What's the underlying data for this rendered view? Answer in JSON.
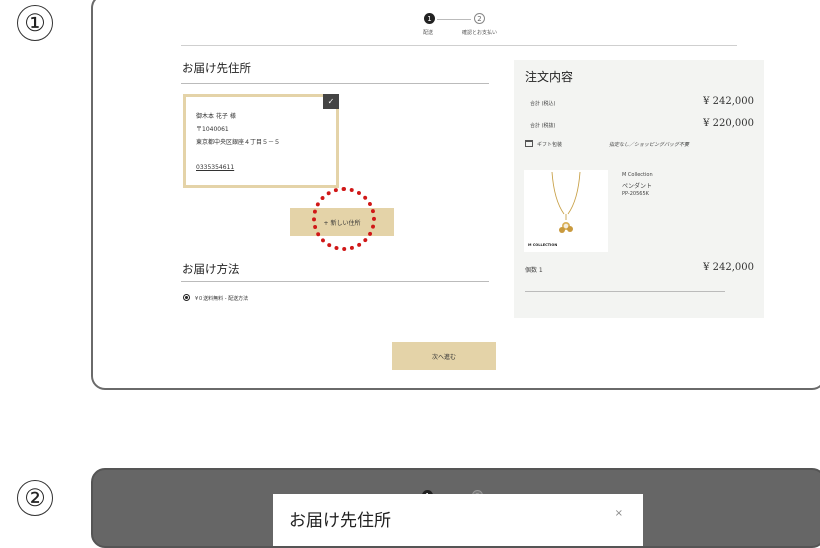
{
  "markers": {
    "first": "①",
    "second": "②"
  },
  "stepper": {
    "step1_number": "1",
    "step1_label": "配送",
    "step2_number": "2",
    "step2_label": "確認とお支払い"
  },
  "shipping_address": {
    "heading": "お届け先住所",
    "name": "御木本 花子 様",
    "postal": "〒1040061",
    "address": "東京都中央区銀座４丁目５－５",
    "phone": "0335354611",
    "check_glyph": "✓",
    "new_address_label": "+ 新しい住所"
  },
  "delivery_method": {
    "heading": "お届け方法",
    "option_label": "¥０送料無料 - 配送方法"
  },
  "next_button_label": "次へ進む",
  "order_summary": {
    "heading": "注文内容",
    "total_incl_label": "合計 (税込)",
    "total_incl_value": "¥ 242,000",
    "total_excl_label": "合計 (税抜)",
    "total_excl_value": "¥ 220,000",
    "gift_label": "ギフト包装",
    "gift_value": "指定なし／ショッピングバッグ不要",
    "product_brand": "M Collection",
    "product_name": "ペンダント",
    "product_code": "PP-20565K",
    "product_logo_text": "M COLLECTION",
    "quantity_label": "個数 1",
    "quantity_price": "¥ 242,000"
  },
  "second_screen": {
    "step1_number": "1",
    "step2_number": "2",
    "modal_title": "お届け先住所",
    "close_glyph": "×"
  },
  "colors": {
    "accent_gold": "#e4d3a8",
    "highlight_red": "#d01818",
    "summary_bg": "#f3f4f2"
  }
}
